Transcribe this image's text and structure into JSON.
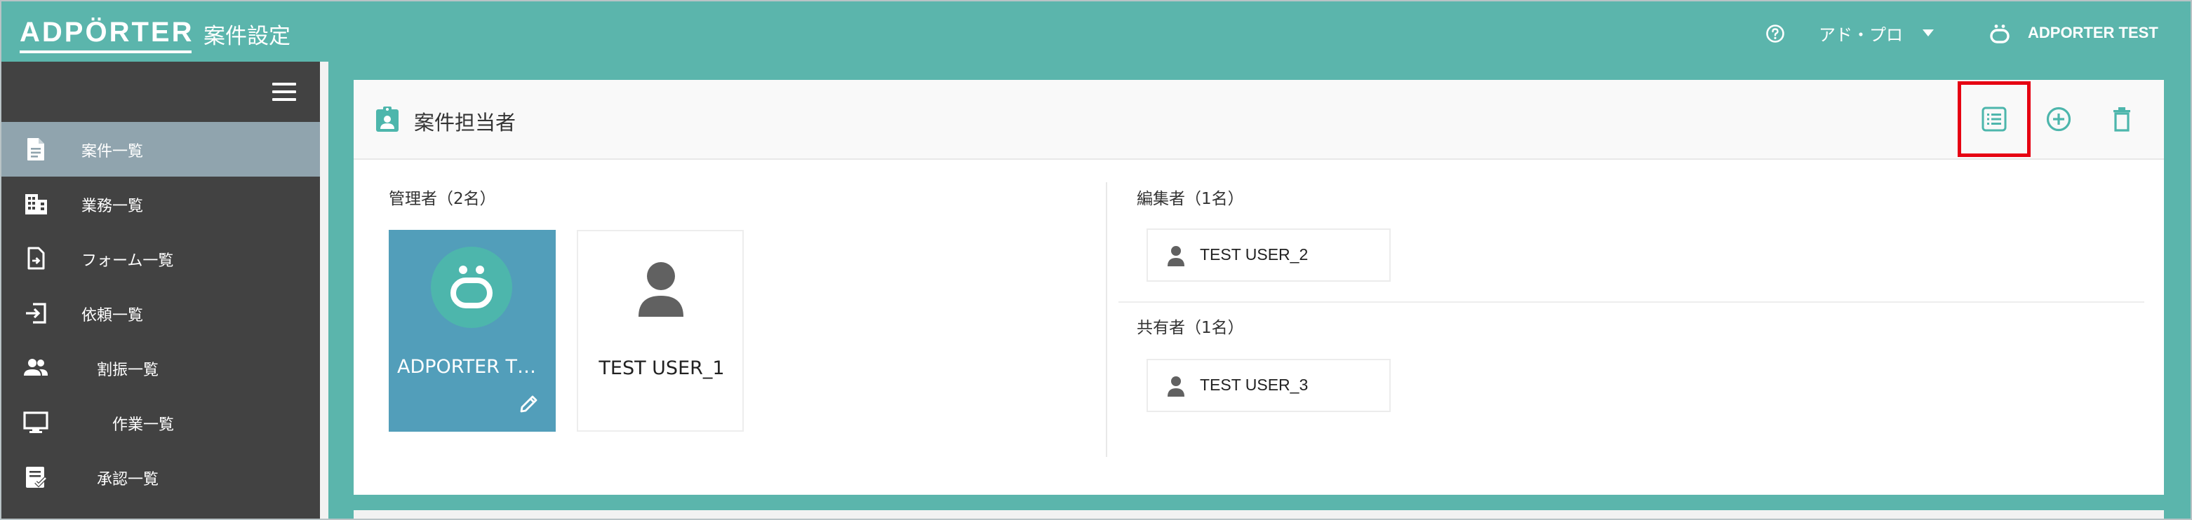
{
  "header": {
    "logo": "ADPÖRTER",
    "page_title": "案件設定",
    "org_selector": "アド・プロ",
    "user_name": "ADPORTER TEST",
    "help_icon": "help-circle-icon",
    "user_icon": "adporter-mascot-icon"
  },
  "sidebar": {
    "menu_icon": "hamburger-menu-icon",
    "items": [
      {
        "label": "案件一覧",
        "icon": "document-icon",
        "active": true
      },
      {
        "label": "業務一覧",
        "icon": "building-icon",
        "active": false
      },
      {
        "label": "フォーム一覧",
        "icon": "form-file-icon",
        "active": false
      },
      {
        "label": "依頼一覧",
        "icon": "request-enter-icon",
        "active": false
      },
      {
        "label": "割振一覧",
        "icon": "people-icon",
        "active": false
      },
      {
        "label": "作業一覧",
        "icon": "monitor-icon",
        "active": false
      },
      {
        "label": "承認一覧",
        "icon": "approval-icon",
        "active": false
      }
    ]
  },
  "card": {
    "title": "案件担当者",
    "title_icon": "assignment-person-icon",
    "actions": [
      {
        "name": "list-view-button",
        "icon": "list-icon",
        "highlighted": true
      },
      {
        "name": "add-button",
        "icon": "add-circle-icon",
        "highlighted": false
      },
      {
        "name": "delete-button",
        "icon": "trash-icon",
        "highlighted": false
      }
    ],
    "managers": {
      "label": "管理者（2名）",
      "members": [
        {
          "name": "ADPORTER TES...",
          "icon": "adporter-mascot-icon",
          "editable": true
        },
        {
          "name": "TEST USER_1",
          "icon": "person-icon",
          "editable": false
        }
      ]
    },
    "editors": {
      "label": "編集者（1名）",
      "members": [
        {
          "name": "TEST USER_2",
          "icon": "person-icon"
        }
      ]
    },
    "sharers": {
      "label": "共有者（1名）",
      "members": [
        {
          "name": "TEST USER_3",
          "icon": "person-icon"
        }
      ]
    }
  },
  "colors": {
    "header_bg": "#5bb5ac",
    "sidebar_bg": "#424242",
    "sidebar_active": "#90a4ae",
    "accent": "#4db6ac",
    "manager_tile": "#529eba",
    "highlight_border": "#e60012"
  }
}
